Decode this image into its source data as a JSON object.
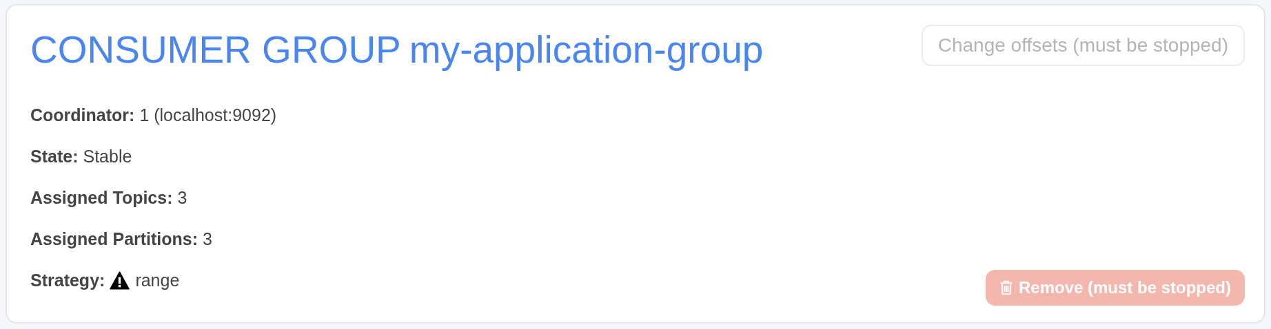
{
  "header": {
    "label": "CONSUMER GROUP",
    "name": "my-application-group"
  },
  "change_offsets_button": {
    "label": "Change offsets (must be stopped)",
    "disabled": true
  },
  "details": [
    {
      "label": "Coordinator:",
      "value": "1 (localhost:9092)",
      "warning": false
    },
    {
      "label": "State:",
      "value": "Stable",
      "warning": false
    },
    {
      "label": "Assigned Topics:",
      "value": "3",
      "warning": false
    },
    {
      "label": "Assigned Partitions:",
      "value": "3",
      "warning": false
    },
    {
      "label": "Strategy:",
      "value": "range",
      "warning": true
    }
  ],
  "remove_button": {
    "label": "Remove (must be stopped)",
    "disabled": true
  }
}
